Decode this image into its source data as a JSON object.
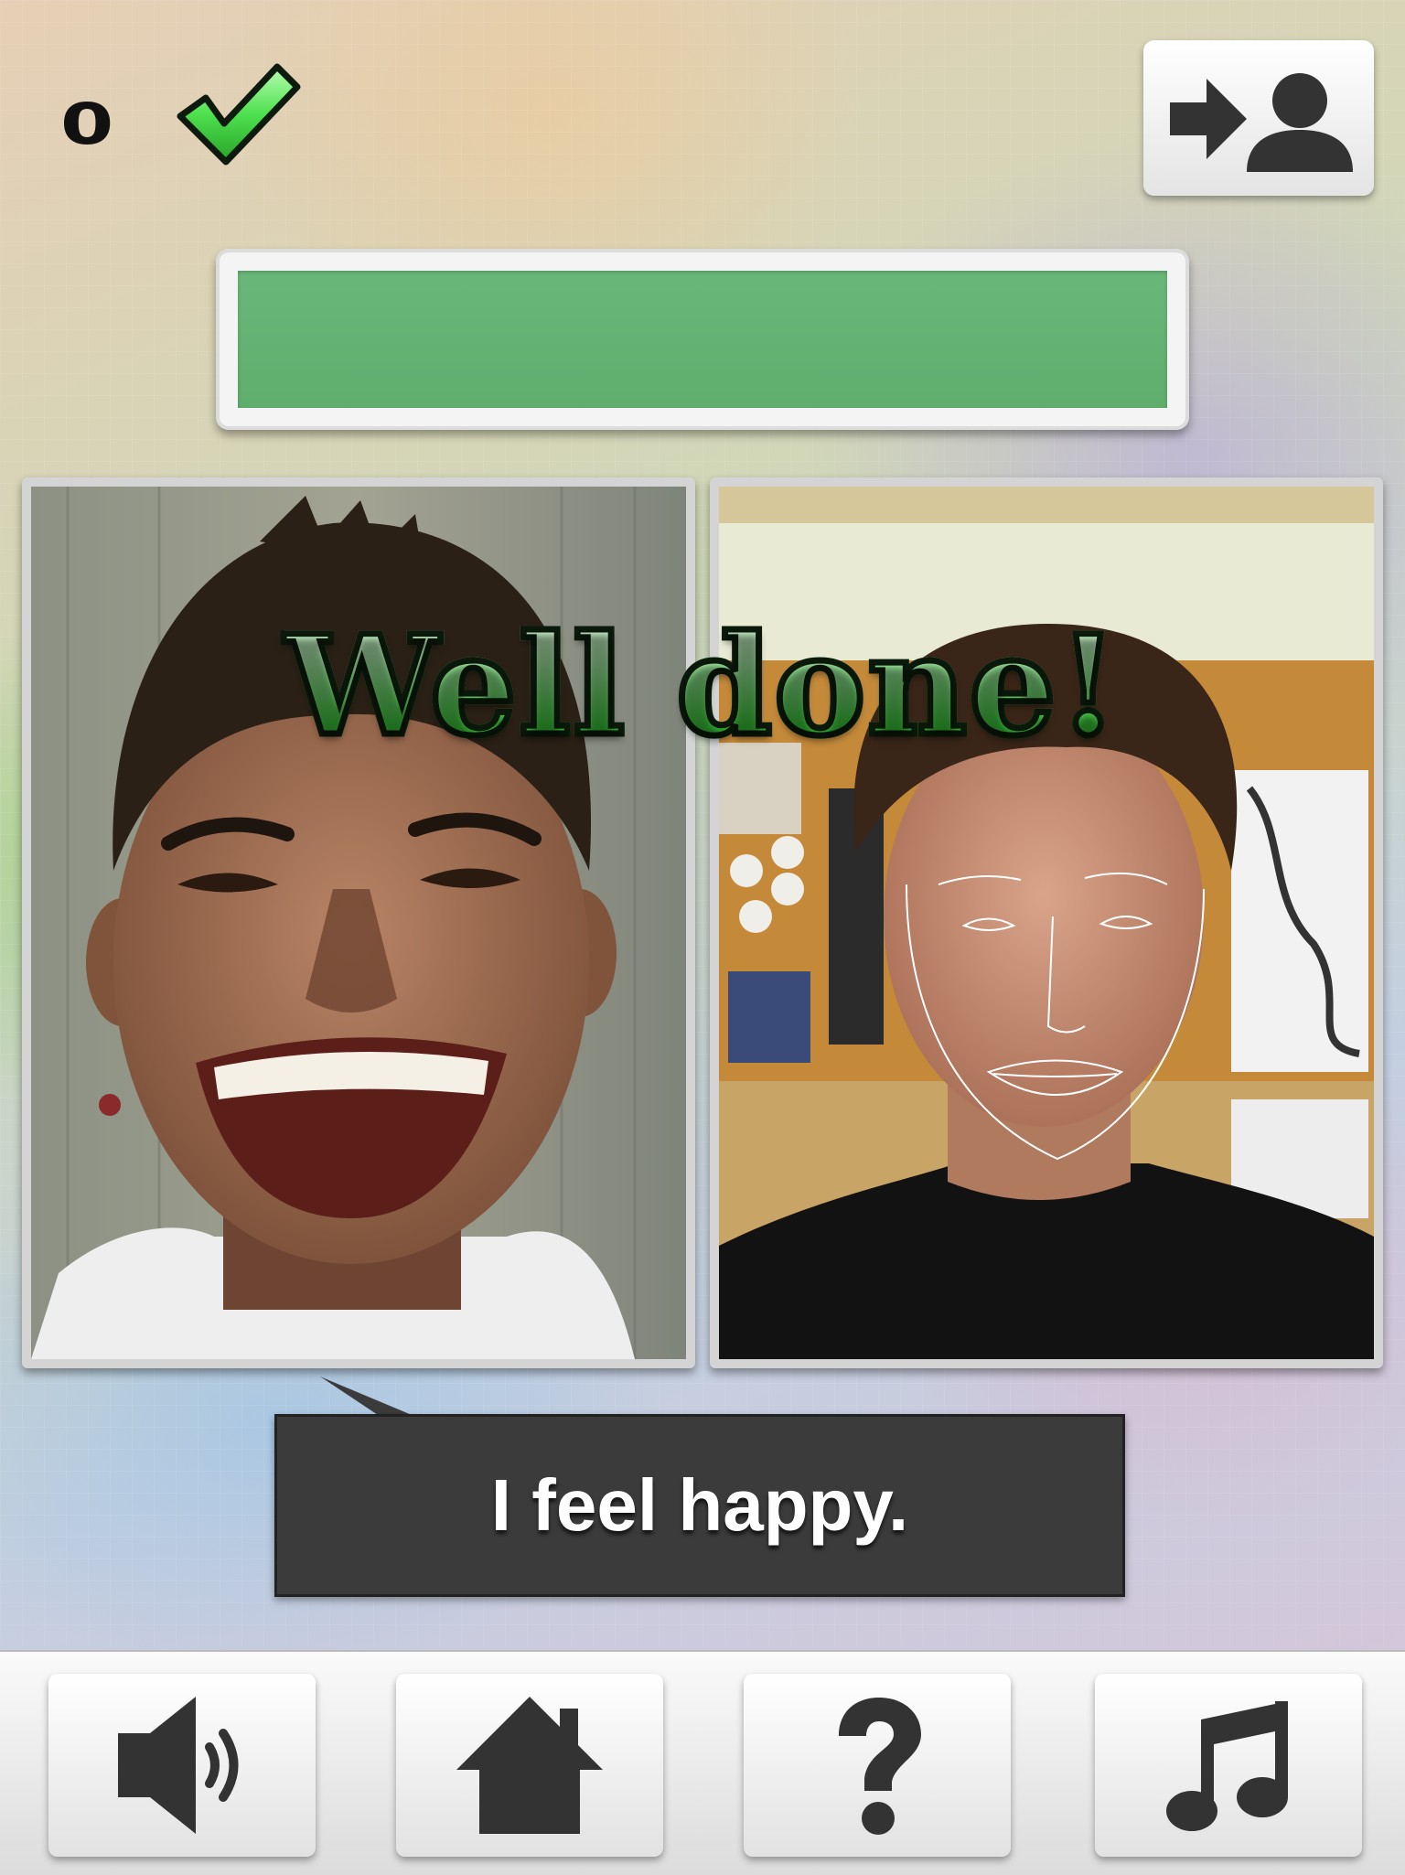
{
  "score": {
    "value": "0"
  },
  "icons": {
    "check": "checkmark-icon",
    "switch_user": "switch-user-icon",
    "sound": "speaker-icon",
    "home": "home-icon",
    "help": "question-mark-icon",
    "music": "music-note-icon"
  },
  "progress": {
    "fraction": 1.0,
    "color": "#5fae6e"
  },
  "feedback": {
    "message": "Well done!"
  },
  "speech": {
    "text": "I feel happy."
  },
  "photos": {
    "target_face": "smiling-person-photo",
    "camera_feed": "webcam-face-tracking"
  },
  "colors": {
    "accent_green": "#4ecf4e",
    "bubble_bg": "#3b3b3b",
    "icon_dark": "#333333"
  }
}
